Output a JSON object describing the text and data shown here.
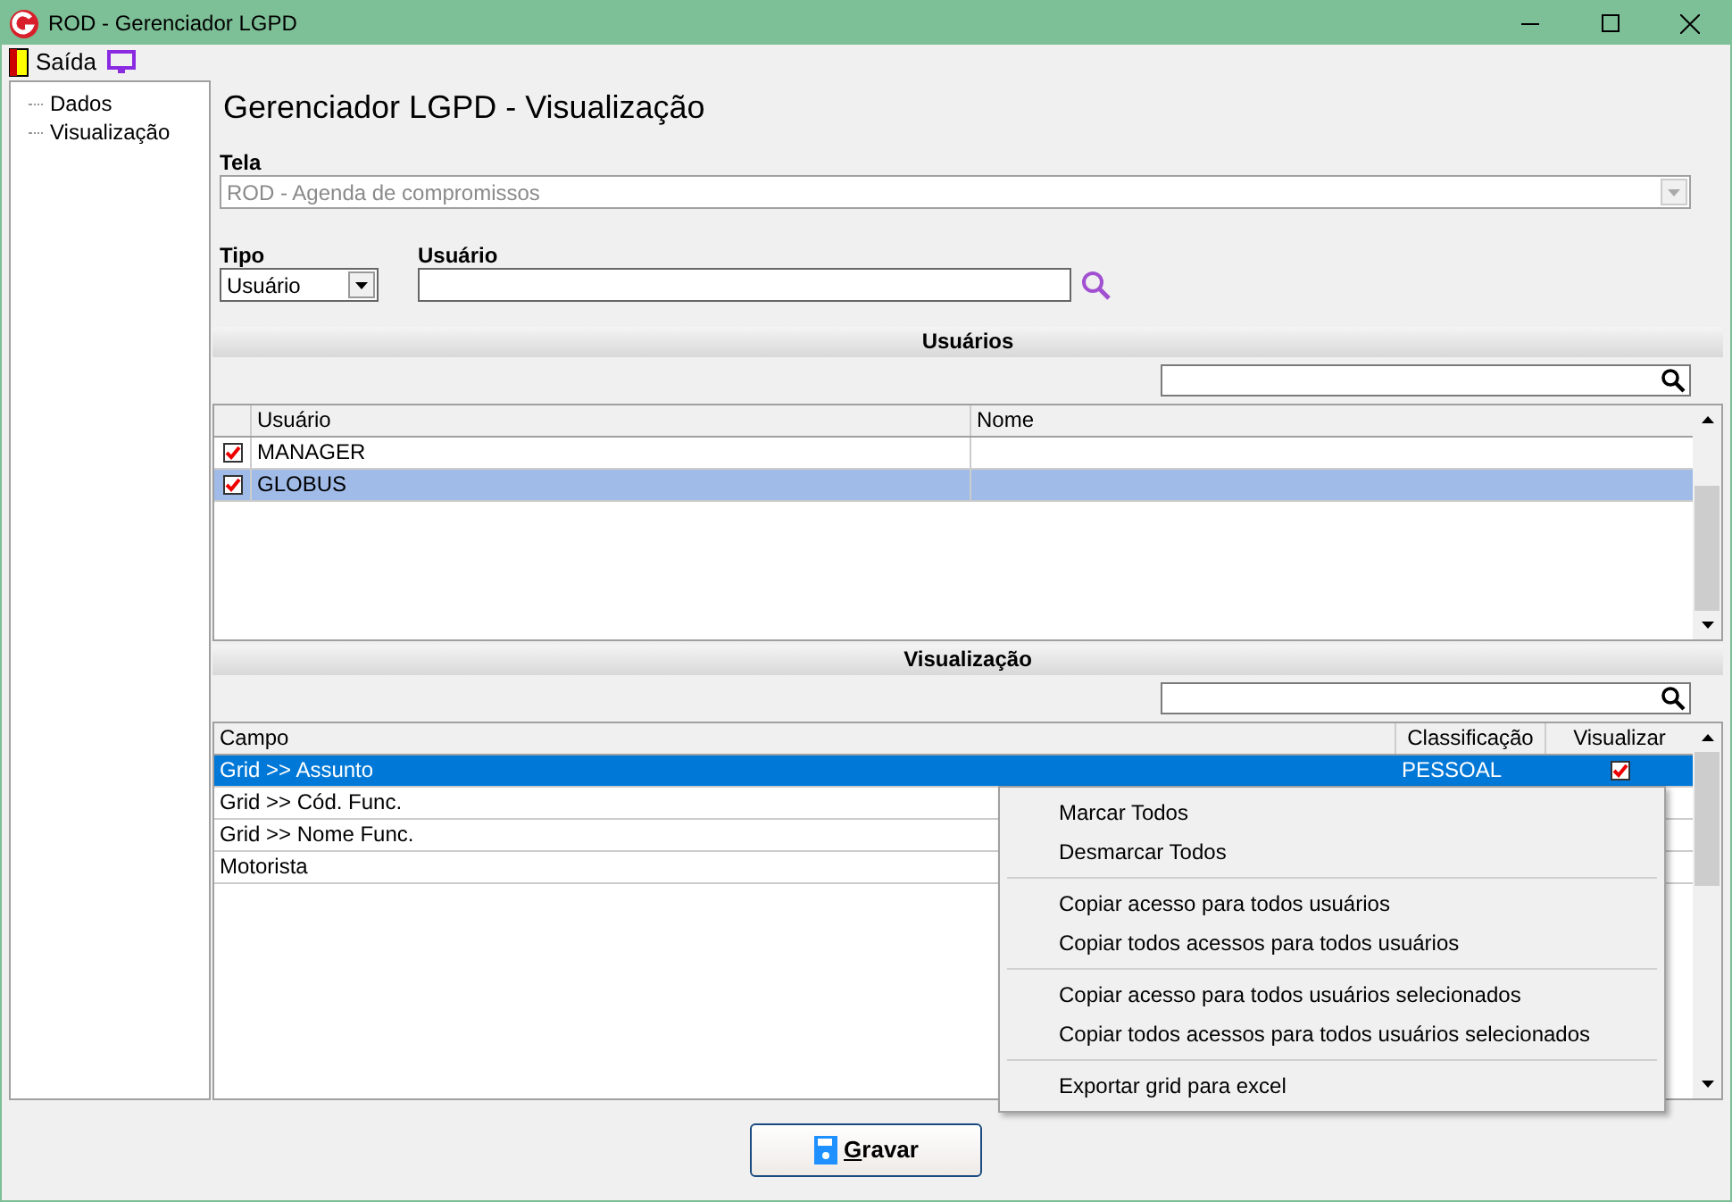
{
  "window": {
    "title": "ROD - Gerenciador LGPD"
  },
  "menu": [
    {
      "label": "Saída",
      "kind": "exit"
    },
    {
      "kind": "screen"
    }
  ],
  "tree": [
    {
      "label": "Dados"
    },
    {
      "label": "Visualização"
    }
  ],
  "heading": "Gerenciador LGPD - Visualização",
  "tela": {
    "label": "Tela",
    "value": "ROD - Agenda de compromissos",
    "disabled": true
  },
  "tipo": {
    "label": "Tipo",
    "value": "Usuário"
  },
  "usuario": {
    "label": "Usuário"
  },
  "usuarios": {
    "title": "Usuários",
    "columns": [
      "Usuário",
      "Nome"
    ],
    "rows": [
      {
        "checked": true,
        "usuario": "MANAGER",
        "nome": "",
        "selected": false
      },
      {
        "checked": true,
        "usuario": "GLOBUS",
        "nome": "",
        "selected": true
      }
    ]
  },
  "visualizacao": {
    "title": "Visualização",
    "columns": [
      "Campo",
      "Classificação",
      "Visualizar"
    ],
    "rows": [
      {
        "campo": "Grid >> Assunto",
        "classificacao": "PESSOAL",
        "visualizar": true,
        "selected": true
      },
      {
        "campo": "Grid >> Cód. Func.",
        "selected": false
      },
      {
        "campo": "Grid >> Nome Func.",
        "selected": false
      },
      {
        "campo": "Motorista",
        "selected": false
      }
    ]
  },
  "context_menu": [
    [
      {
        "label": "Marcar Todos"
      },
      {
        "label": "Desmarcar Todos"
      }
    ],
    [
      {
        "label": "Copiar acesso para todos usuários"
      },
      {
        "label": "Copiar todos acessos para todos usuários"
      }
    ],
    [
      {
        "label": "Copiar acesso para todos usuários selecionados"
      },
      {
        "label": "Copiar todos acessos para todos usuários selecionados"
      }
    ],
    [
      {
        "label": "Exportar grid para excel"
      }
    ]
  ],
  "save_button": {
    "label": "Gravar",
    "mnemonic": true
  }
}
